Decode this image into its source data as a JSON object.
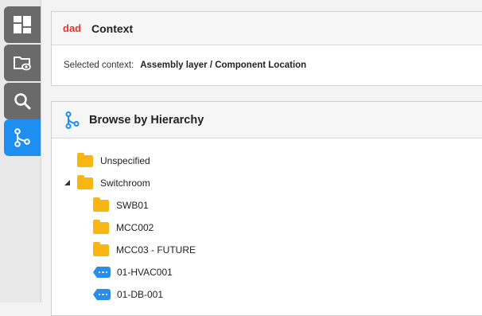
{
  "sidebar": {
    "items": [
      {
        "name": "dashboard",
        "icon": "dashboard-icon"
      },
      {
        "name": "view-folder",
        "icon": "folder-eye-icon"
      },
      {
        "name": "search",
        "icon": "search-icon"
      },
      {
        "name": "hierarchy",
        "icon": "hierarchy-icon",
        "active": true
      }
    ]
  },
  "context": {
    "logo_text": "dad",
    "title": "Context",
    "selected_label": "Selected context:",
    "selected_value": "Assembly layer / Component Location"
  },
  "hierarchy": {
    "title": "Browse by Hierarchy",
    "items": [
      {
        "label": "Unspecified",
        "type": "folder",
        "level": 0,
        "expanded": false
      },
      {
        "label": "Switchroom",
        "type": "folder",
        "level": 0,
        "expanded": true
      },
      {
        "label": "SWB01",
        "type": "folder",
        "level": 1
      },
      {
        "label": "MCC002",
        "type": "folder",
        "level": 1
      },
      {
        "label": "MCC03 - FUTURE",
        "type": "folder",
        "level": 1
      },
      {
        "label": "01-HVAC001",
        "type": "tag",
        "level": 1
      },
      {
        "label": "01-DB-001",
        "type": "tag",
        "level": 1
      }
    ]
  },
  "colors": {
    "accent": "#1e8ff0",
    "folder": "#f9b612",
    "tag": "#2b8de8",
    "sidebar_button": "#6a6a6a"
  }
}
